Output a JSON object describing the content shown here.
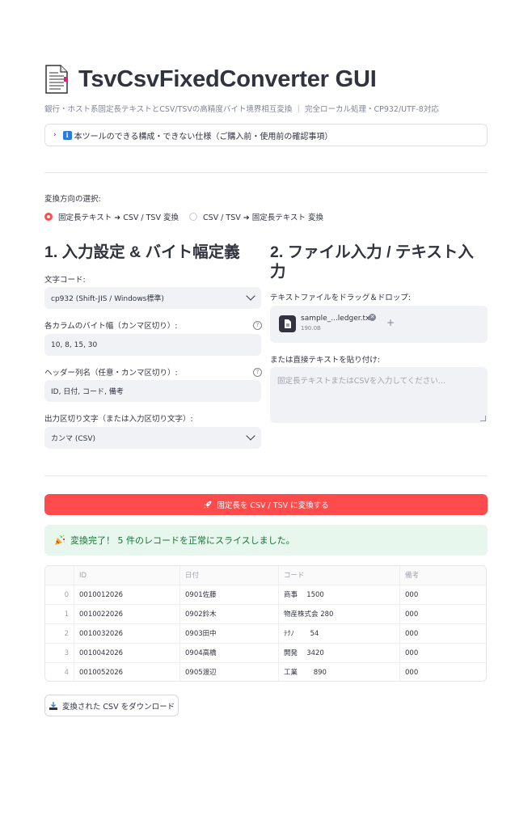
{
  "app": {
    "title": "TsvCsvFixedConverter GUI",
    "caption": "銀行・ホスト系固定長テキストとCSV/TSVの高精度バイト境界相互変換 ｜ 完全ローカル処理・CP932/UTF-8対応"
  },
  "expander": {
    "label": "本ツールのできる構成・できない仕様（ご購入前・使用前の確認事項）",
    "icon": "information-icon"
  },
  "direction": {
    "label": "変換方向の選択:",
    "options": [
      "固定長テキスト ➜ CSV / TSV 変換",
      "CSV / TSV ➜ 固定長テキスト 変換"
    ],
    "selected_index": 0
  },
  "section1": {
    "heading": "1. 入力設定 & バイト幅定義",
    "encoding_label": "文字コード:",
    "encoding_value": "cp932 (Shift-JIS / Windows標準)",
    "widths_label": "各カラムのバイト幅（カンマ区切り）:",
    "widths_value": "10, 8, 15, 30",
    "headers_label": "ヘッダー列名（任意・カンマ区切り）:",
    "headers_value": "ID, 日付, コード, 備考",
    "delimiter_label": "出力区切り文字（または入力区切り文字）:",
    "delimiter_value": "カンマ (CSV)"
  },
  "section2": {
    "heading_line1": "2. ファイル入力 / テキスト入",
    "heading_line2": "力",
    "upload_label": "テキストファイルをドラッグ＆ドロップ:",
    "file_name": "sample_...ledger.txt",
    "file_size": "190.0B",
    "paste_label": "または直接テキストを貼り付け:",
    "paste_placeholder": "固定長テキストまたはCSVを入力してください..."
  },
  "convert_button": "固定長を CSV / TSV に変換する",
  "success_message": "変換完了！ 5 件のレコードを正常にスライスしました。",
  "table": {
    "columns": [
      "ID",
      "日付",
      "コード",
      "備考"
    ],
    "rows": [
      [
        "0",
        "0010012026",
        "0901佐藤",
        "商事　 1500",
        "000"
      ],
      [
        "1",
        "0010022026",
        "0902鈴木",
        "物産株式会 280",
        "000"
      ],
      [
        "2",
        "0010032026",
        "0903田中",
        "ﾃｸﾉ　　 54",
        "000"
      ],
      [
        "3",
        "0010042026",
        "0904高橋",
        "開発　 3420",
        "000"
      ],
      [
        "4",
        "0010052026",
        "0905渡辺",
        "工業　　 890",
        "000"
      ]
    ]
  },
  "download_button": "変換された CSV をダウンロード",
  "colors": {
    "primary": "#ff4b4b",
    "success_bg": "#e8f7ee",
    "success_text": "#177233",
    "input_bg": "#f0f2f6"
  }
}
